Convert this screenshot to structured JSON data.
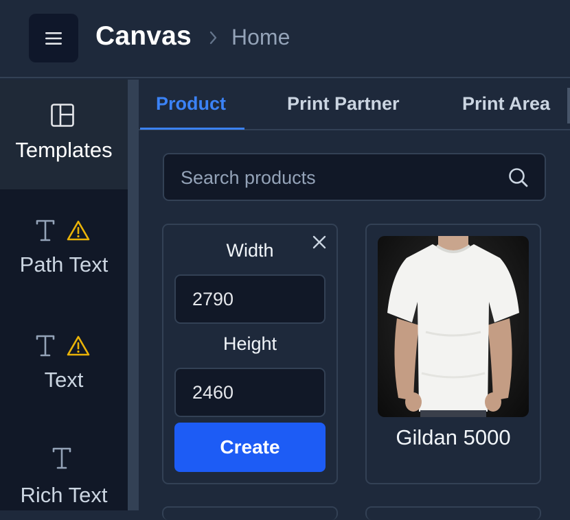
{
  "header": {
    "app_title": "Canvas",
    "breadcrumb": "Home",
    "menu_icon": "hamburger-icon"
  },
  "sidebar": {
    "items": [
      {
        "label": "Templates",
        "icon": "layout-icon",
        "active": true,
        "warning": false
      },
      {
        "label": "Path Text",
        "icon": "text-icon",
        "active": false,
        "warning": true
      },
      {
        "label": "Text",
        "icon": "text-icon",
        "active": false,
        "warning": true
      },
      {
        "label": "Rich Text",
        "icon": "text-icon",
        "active": false,
        "warning": false
      }
    ]
  },
  "tabs": [
    {
      "label": "Product",
      "active": true
    },
    {
      "label": "Print Partner",
      "active": false
    },
    {
      "label": "Print Area",
      "active": false
    }
  ],
  "search": {
    "placeholder": "Search products",
    "value": ""
  },
  "custom_size": {
    "width_label": "Width",
    "width_value": "2790",
    "height_label": "Height",
    "height_value": "2460",
    "create_label": "Create"
  },
  "products": [
    {
      "name": "Gildan 5000",
      "image": "white-tshirt-model"
    }
  ],
  "colors": {
    "accent": "#3b82f6",
    "primary_button": "#1d5cf5",
    "warning": "#eab308",
    "background": "#1e293b",
    "sidebar": "#111827"
  }
}
